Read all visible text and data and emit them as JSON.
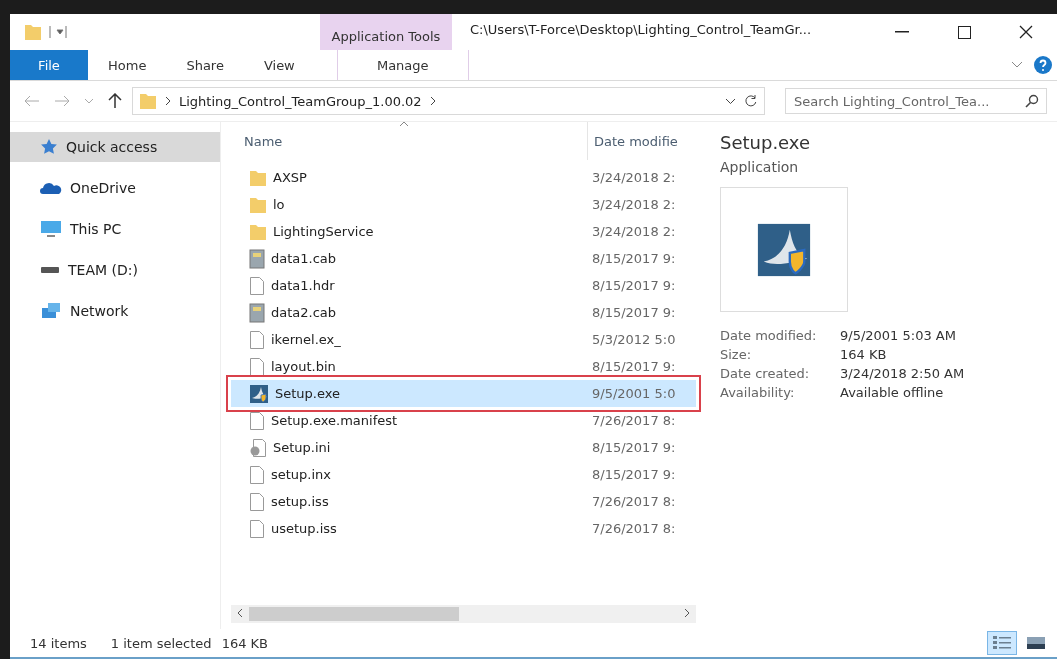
{
  "window": {
    "title": "C:\\Users\\T-Force\\Desktop\\Lighting_Control_TeamGr...",
    "context_tab": "Application Tools"
  },
  "ribbon_tabs": [
    {
      "label": "File",
      "kind": "file",
      "selected": false
    },
    {
      "label": "Home",
      "kind": "tab",
      "selected": false
    },
    {
      "label": "Share",
      "kind": "tab",
      "selected": false
    },
    {
      "label": "View",
      "kind": "tab",
      "selected": false
    },
    {
      "label": "Manage",
      "kind": "context",
      "selected": false
    }
  ],
  "address": {
    "path": "Lighting_Control_TeamGroup_1.00.02"
  },
  "search": {
    "placeholder": "Search Lighting_Control_Tea..."
  },
  "nav_items": [
    {
      "label": "Quick access",
      "kind": "star",
      "selected": true
    },
    {
      "label": "OneDrive",
      "kind": "cloud",
      "selected": false
    },
    {
      "label": "This PC",
      "kind": "pc",
      "selected": false
    },
    {
      "label": "TEAM (D:)",
      "kind": "drive",
      "selected": false
    },
    {
      "label": "Network",
      "kind": "network",
      "selected": false
    }
  ],
  "columns": [
    "Name",
    "Date modifie"
  ],
  "files": [
    {
      "name": "AXSP",
      "date": "3/24/2018 2:",
      "kind": "folder",
      "selected": false,
      "outlined": false
    },
    {
      "name": "lo",
      "date": "3/24/2018 2:",
      "kind": "folder",
      "selected": false,
      "outlined": false
    },
    {
      "name": "LightingService",
      "date": "3/24/2018 2:",
      "kind": "folder",
      "selected": false,
      "outlined": false
    },
    {
      "name": "data1.cab",
      "date": "8/15/2017 9:",
      "kind": "cab",
      "selected": false,
      "outlined": false
    },
    {
      "name": "data1.hdr",
      "date": "8/15/2017 9:",
      "kind": "file",
      "selected": false,
      "outlined": false
    },
    {
      "name": "data2.cab",
      "date": "8/15/2017 9:",
      "kind": "cab",
      "selected": false,
      "outlined": false
    },
    {
      "name": "ikernel.ex_",
      "date": "5/3/2012 5:0",
      "kind": "file",
      "selected": false,
      "outlined": false
    },
    {
      "name": "layout.bin",
      "date": "8/15/2017 9:",
      "kind": "file",
      "selected": false,
      "outlined": false
    },
    {
      "name": "Setup.exe",
      "date": "9/5/2001 5:0",
      "kind": "exe",
      "selected": true,
      "outlined": true
    },
    {
      "name": "Setup.exe.manifest",
      "date": "7/26/2017 8:",
      "kind": "file",
      "selected": false,
      "outlined": false
    },
    {
      "name": "Setup.ini",
      "date": "8/15/2017 9:",
      "kind": "ini",
      "selected": false,
      "outlined": false
    },
    {
      "name": "setup.inx",
      "date": "8/15/2017 9:",
      "kind": "file",
      "selected": false,
      "outlined": false
    },
    {
      "name": "setup.iss",
      "date": "7/26/2017 8:",
      "kind": "file",
      "selected": false,
      "outlined": false
    },
    {
      "name": "usetup.iss",
      "date": "7/26/2017 8:",
      "kind": "file",
      "selected": false,
      "outlined": false
    }
  ],
  "details": {
    "title": "Setup.exe",
    "type": "Application",
    "properties": [
      {
        "label": "Date modified:",
        "value": "9/5/2001 5:03 AM"
      },
      {
        "label": "Size:",
        "value": "164 KB"
      },
      {
        "label": "Date created:",
        "value": "3/24/2018 2:50 AM"
      },
      {
        "label": "Availability:",
        "value": "Available offline"
      }
    ]
  },
  "status_bar": {
    "count": "14 items",
    "selection": "1 item selected",
    "size": "164 KB"
  },
  "view_buttons": [
    {
      "kind": "details",
      "selected": true
    },
    {
      "kind": "tiles",
      "selected": false
    }
  ]
}
